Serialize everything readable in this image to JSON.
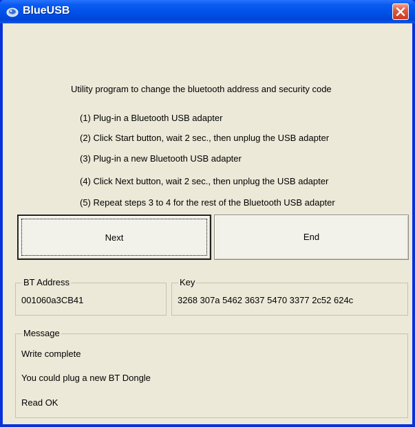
{
  "window": {
    "title": "BlueUSB"
  },
  "intro": "Utility program to change the bluetooth address and security code",
  "steps": [
    "(1) Plug-in a Bluetooth USB adapter",
    "(2) Click Start button, wait 2 sec., then unplug the USB adapter",
    "(3) Plug-in a new Bluetooth USB adapter",
    "(4) Click Next button, wait 2 sec., then  unplug the USB adapter",
    "(5) Repeat steps 3 to 4 for the rest of the Bluetooth  USB adapter"
  ],
  "buttons": {
    "next": "Next",
    "end": "End"
  },
  "bt_address": {
    "label": "BT Address",
    "value": "001060a3CB41"
  },
  "key": {
    "label": "Key",
    "value": "3268 307a 5462 3637 5470 3377 2c52 624c"
  },
  "message": {
    "label": "Message",
    "lines": [
      "Write complete",
      "You could plug a new BT Dongle",
      "Read OK"
    ]
  },
  "icons": {
    "app": "bluetooth-app-icon",
    "close": "close-icon"
  },
  "colors": {
    "titlebar": "#0050e8",
    "client_bg": "#ece9d8",
    "close_button": "#e2583e"
  }
}
